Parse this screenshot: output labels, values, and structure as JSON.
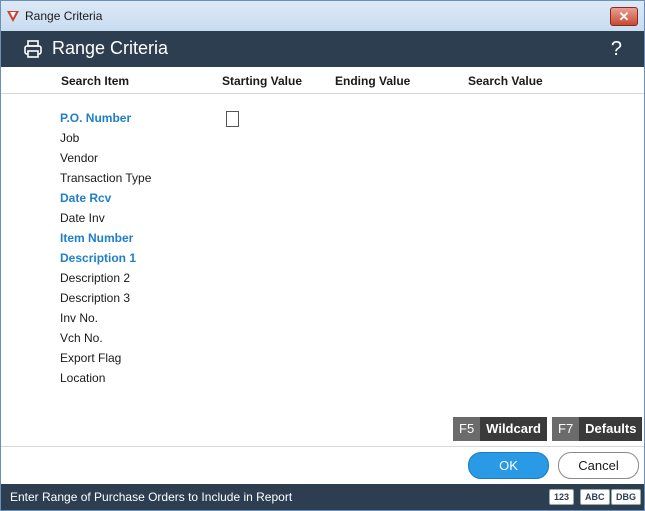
{
  "window": {
    "title": "Range Criteria",
    "close_symbol": "✕"
  },
  "header": {
    "title": "Range Criteria",
    "help_symbol": "?"
  },
  "columns": [
    "Search Item",
    "Starting Value",
    "Ending Value",
    "Search Value"
  ],
  "search_items": [
    {
      "label": "P.O. Number",
      "highlighted": true
    },
    {
      "label": "Job",
      "highlighted": false
    },
    {
      "label": "Vendor",
      "highlighted": false
    },
    {
      "label": "Transaction Type",
      "highlighted": false
    },
    {
      "label": "Date Rcv",
      "highlighted": true
    },
    {
      "label": "Date Inv",
      "highlighted": false
    },
    {
      "label": "Item Number",
      "highlighted": true
    },
    {
      "label": "Description 1",
      "highlighted": true
    },
    {
      "label": "Description 2",
      "highlighted": false
    },
    {
      "label": "Description 3",
      "highlighted": false
    },
    {
      "label": "Inv No.",
      "highlighted": false
    },
    {
      "label": "Vch No.",
      "highlighted": false
    },
    {
      "label": "Export Flag",
      "highlighted": false
    },
    {
      "label": "Location",
      "highlighted": false
    }
  ],
  "function_keys": [
    {
      "key": "F5",
      "label": "Wildcard"
    },
    {
      "key": "F7",
      "label": "Defaults"
    }
  ],
  "buttons": {
    "ok": "OK",
    "cancel": "Cancel"
  },
  "status_bar": {
    "message": "Enter Range of Purchase Orders to Include in Report",
    "badges": [
      "123",
      "ABC",
      "DBG"
    ]
  },
  "colors": {
    "header_bg": "#2c3e50",
    "highlight_text": "#1f7fc8",
    "ok_button": "#2a9ae6"
  }
}
